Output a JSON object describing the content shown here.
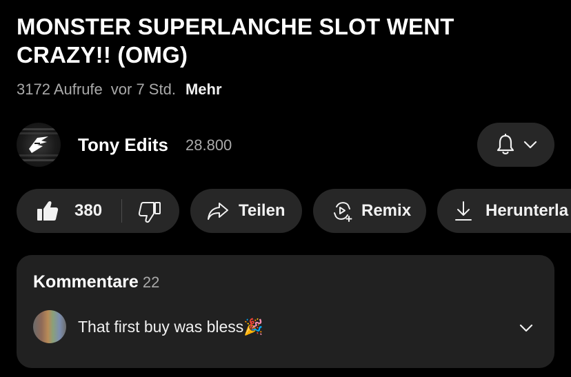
{
  "video": {
    "title": "MONSTER SUPERLANCHE SLOT WENT CRAZY!! (OMG)",
    "views": "3172 Aufrufe",
    "age": "vor 7 Std.",
    "more_label": "Mehr"
  },
  "channel": {
    "name": "Tony Edits",
    "subscribers": "28.800",
    "avatar_icon": "channel-logo-icon",
    "bell_icon": "bell-icon",
    "dropdown_icon": "chevron-down-icon"
  },
  "actions": {
    "like_count": "380",
    "like_icon": "thumbs-up-icon",
    "dislike_icon": "thumbs-down-icon",
    "share_label": "Teilen",
    "share_icon": "share-arrow-icon",
    "remix_label": "Remix",
    "remix_icon": "remix-icon",
    "download_label": "Herunterla",
    "download_icon": "download-icon"
  },
  "comments": {
    "heading": "Kommentare",
    "count": "22",
    "top_comment": {
      "text": "That first buy was bless🎉",
      "expand_icon": "chevron-down-icon"
    }
  },
  "colors": {
    "background": "#000000",
    "pill": "#272727",
    "comment_card": "#212121",
    "secondary_text": "#aaaaaa"
  }
}
